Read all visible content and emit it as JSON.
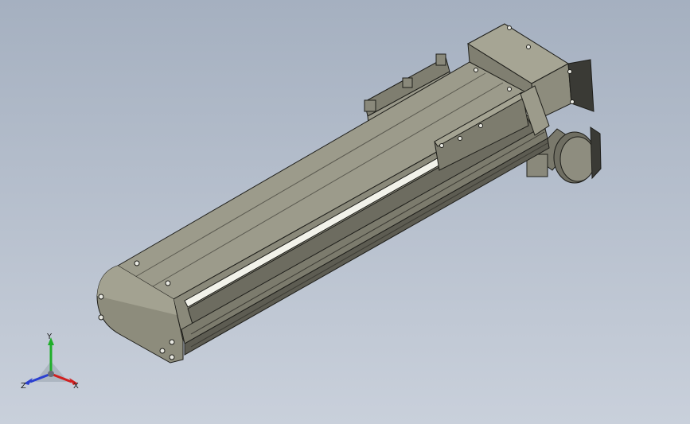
{
  "viewport": {
    "background_top": "#a5b0c0",
    "background_bottom": "#c9d0db",
    "model": "linear-actuator-with-servo-motor",
    "part_color": "#8f8e7f",
    "edge_color": "#1e1e1a"
  },
  "triad": {
    "x_label": "X",
    "y_label": "Y",
    "z_label": "Z",
    "x_color": "#d11f1f",
    "y_color": "#1fae2a",
    "z_color": "#2a3fd0"
  }
}
